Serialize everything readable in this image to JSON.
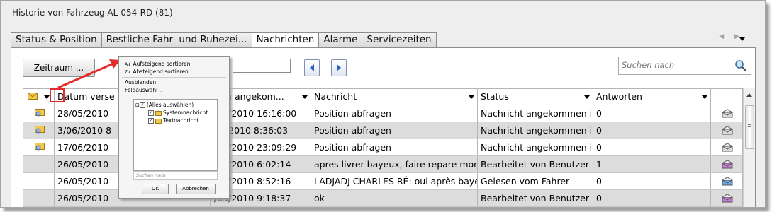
{
  "window": {
    "title": "Historie von Fahrzeug AL-054-RD (81)"
  },
  "tabs": [
    {
      "label": "Status & Position",
      "active": false
    },
    {
      "label": "Restliche Fahr- und Ruhezei...",
      "active": false
    },
    {
      "label": "Nachrichten",
      "active": true
    },
    {
      "label": "Alarme",
      "active": false
    },
    {
      "label": "Servicezeiten",
      "active": false
    }
  ],
  "toolbar": {
    "period_button": "Zeitraum ...",
    "search_placeholder": "Suchen nach"
  },
  "table": {
    "columns": [
      "",
      "Datum verse",
      "tum angekom...",
      "Nachricht",
      "Status",
      "Antworten"
    ],
    "rows": [
      {
        "has_icon": true,
        "sent": "28/05/2010",
        "received": "/05/2010 16:16:00",
        "message": "Position abfragen",
        "status": "Nachricht angekommen i...",
        "answers": "0",
        "envelope": "grey"
      },
      {
        "has_icon": true,
        "sent": "3/06/2010 8",
        "received": "06/2010 8:36:03",
        "message": "Position abfragen",
        "status": "Nachricht angekommen i...",
        "answers": "0",
        "envelope": "grey"
      },
      {
        "has_icon": true,
        "sent": "17/06/2010",
        "received": "/06/2010 23:09:29",
        "message": "Position abfragen",
        "status": "Nachricht angekommen i...",
        "answers": "0",
        "envelope": "grey"
      },
      {
        "has_icon": false,
        "sent": "26/05/2010",
        "received": "/05/2010 6:02:14",
        "message": "apres livrer bayeux, faire repare mon fri...",
        "status": "Bearbeitet von Benutzer",
        "answers": "1",
        "envelope": "purple"
      },
      {
        "has_icon": false,
        "sent": "26/05/2010",
        "received": "/05/2010 8:52:16",
        "message": "LADJADJ CHARLES  RÉ: oui après baye...",
        "status": "Gelesen vom Fahrer",
        "answers": "0",
        "envelope": "blue"
      },
      {
        "has_icon": false,
        "sent": "26/05/2010",
        "received": "/05/2010 9:18:37",
        "message": "ok",
        "status": "Bearbeitet von Benutzer",
        "answers": "0",
        "envelope": "purple"
      }
    ]
  },
  "popup": {
    "sort_asc": "Aufsteigend sortieren",
    "sort_desc": "Absteigend sortieren",
    "hide": "Ausblenden",
    "field_select": "Feldauswahl ..",
    "select_all": "(Alles auswählen)",
    "items": [
      "Systemnachricht",
      "Textnachricht"
    ],
    "search_placeholder": "Suchen nach",
    "ok": "OK",
    "cancel": "Abbrechen"
  },
  "colors": {
    "annotation_red": "#e32b2b",
    "row_alt": "#dcdcdc",
    "nav_blue": "#2b5fbf"
  }
}
